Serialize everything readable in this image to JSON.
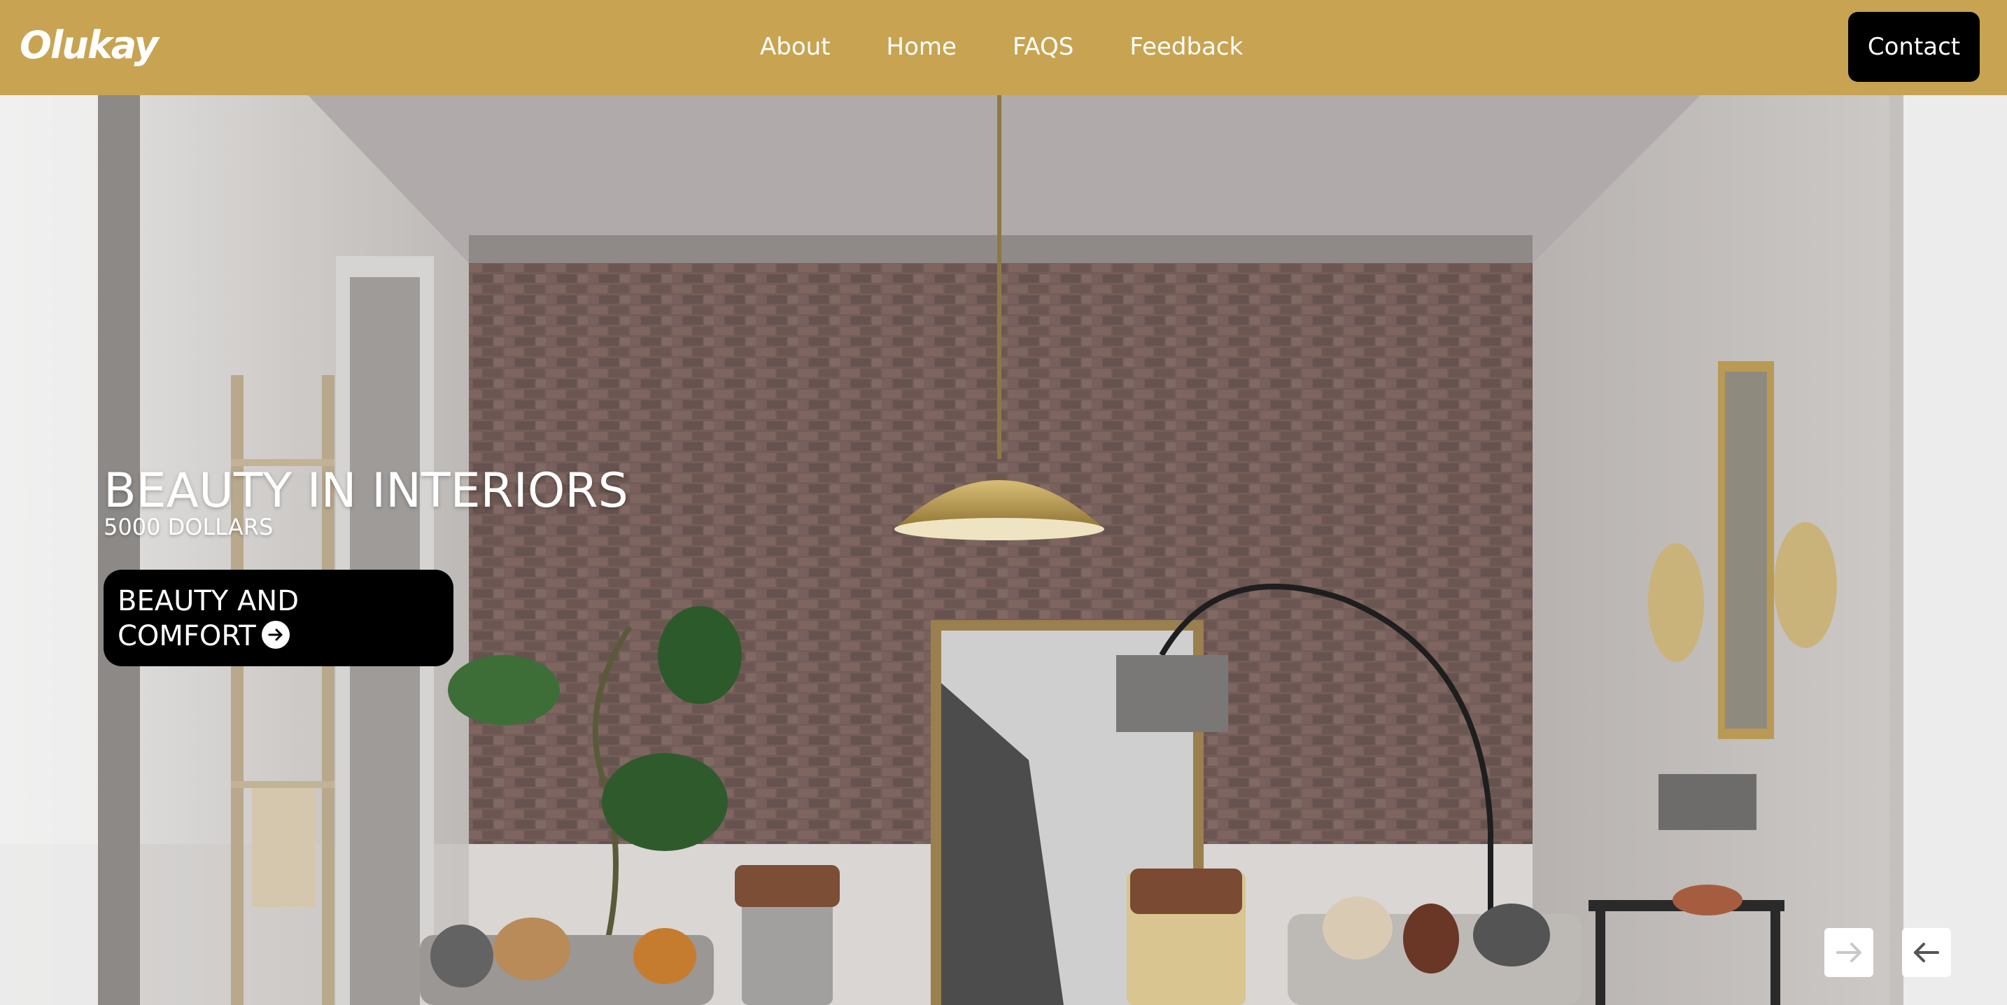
{
  "header": {
    "logo": "Olukay",
    "nav": [
      "About",
      "Home",
      "FAQS",
      "Feedback"
    ],
    "contact_label": "Contact"
  },
  "hero": {
    "title": "BEAUTY IN INTERIORS",
    "price": "5000 DOLLARS",
    "cta_line1": "BEAUTY AND",
    "cta_line2": "COMFORT",
    "cta_icon": "arrow-right-circle-icon",
    "next_icon": "arrow-right-icon",
    "prev_icon": "arrow-left-icon"
  },
  "colors": {
    "header_bg": "#c8a452",
    "button_bg": "#000000",
    "text": "#ffffff"
  }
}
